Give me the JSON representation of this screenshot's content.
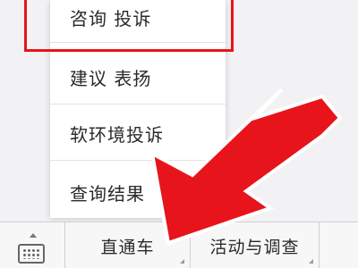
{
  "menu": {
    "items": [
      {
        "label": "咨询  投诉"
      },
      {
        "label": "建议  表扬"
      },
      {
        "label": "软环境投诉"
      },
      {
        "label": "查询结果"
      }
    ]
  },
  "bottom_bar": {
    "keyboard_icon": "keyboard-icon",
    "tabs": [
      {
        "label": "直通车"
      },
      {
        "label": "活动与调查"
      },
      {
        "label": ""
      }
    ]
  },
  "annotation": {
    "highlight_color": "#e8141b",
    "arrow_color": "#e8141b"
  }
}
